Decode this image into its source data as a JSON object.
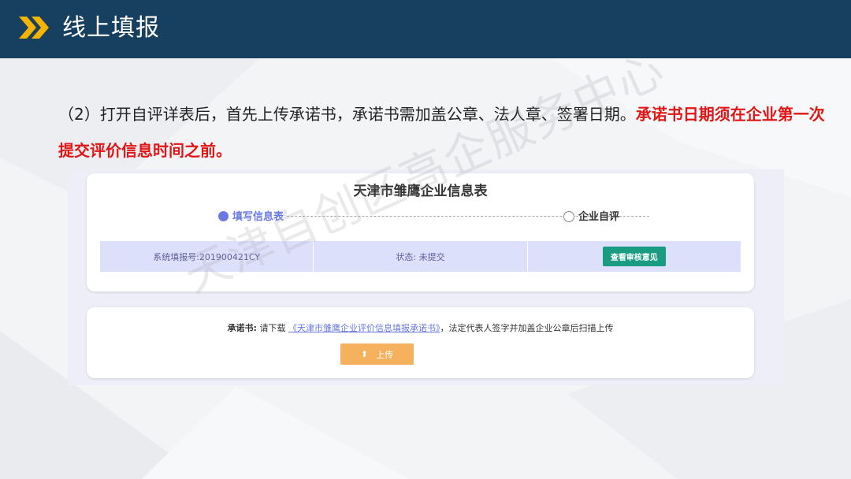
{
  "header": {
    "title": "线上填报"
  },
  "instruction": {
    "normal": "（2）打开自评详表后，首先上传承诺书，承诺书需加盖公章、法人章、签署日期。",
    "emphasis": "承诺书日期须在企业第一次提交评价信息时间之前。"
  },
  "form": {
    "title": "天津市雏鹰企业信息表",
    "steps": [
      {
        "label": "填写信息表",
        "active": true
      },
      {
        "label": "企业自评",
        "active": false
      }
    ],
    "info": {
      "system_no": "系统填报号:201900421CY",
      "status": "状态: 未提交",
      "review_button": "查看审核意见"
    },
    "promise": {
      "label": "承诺书:",
      "prefix": " 请下载 ",
      "link": "《天津市雏鹰企业评价信息填报承诺书》",
      "suffix": "，法定代表人签字并加盖企业公章后扫描上传"
    },
    "upload_button": "上传"
  },
  "watermark": "天津自创区高企服务中心",
  "colors": {
    "header_bg": "#173f5f",
    "accent_yellow": "#f5b400",
    "emphasis_red": "#e01515",
    "step_active": "#6a78e0",
    "review_button": "#1a9c82",
    "upload_button": "#f6b15f",
    "info_row_bg": "#dde0fb"
  }
}
